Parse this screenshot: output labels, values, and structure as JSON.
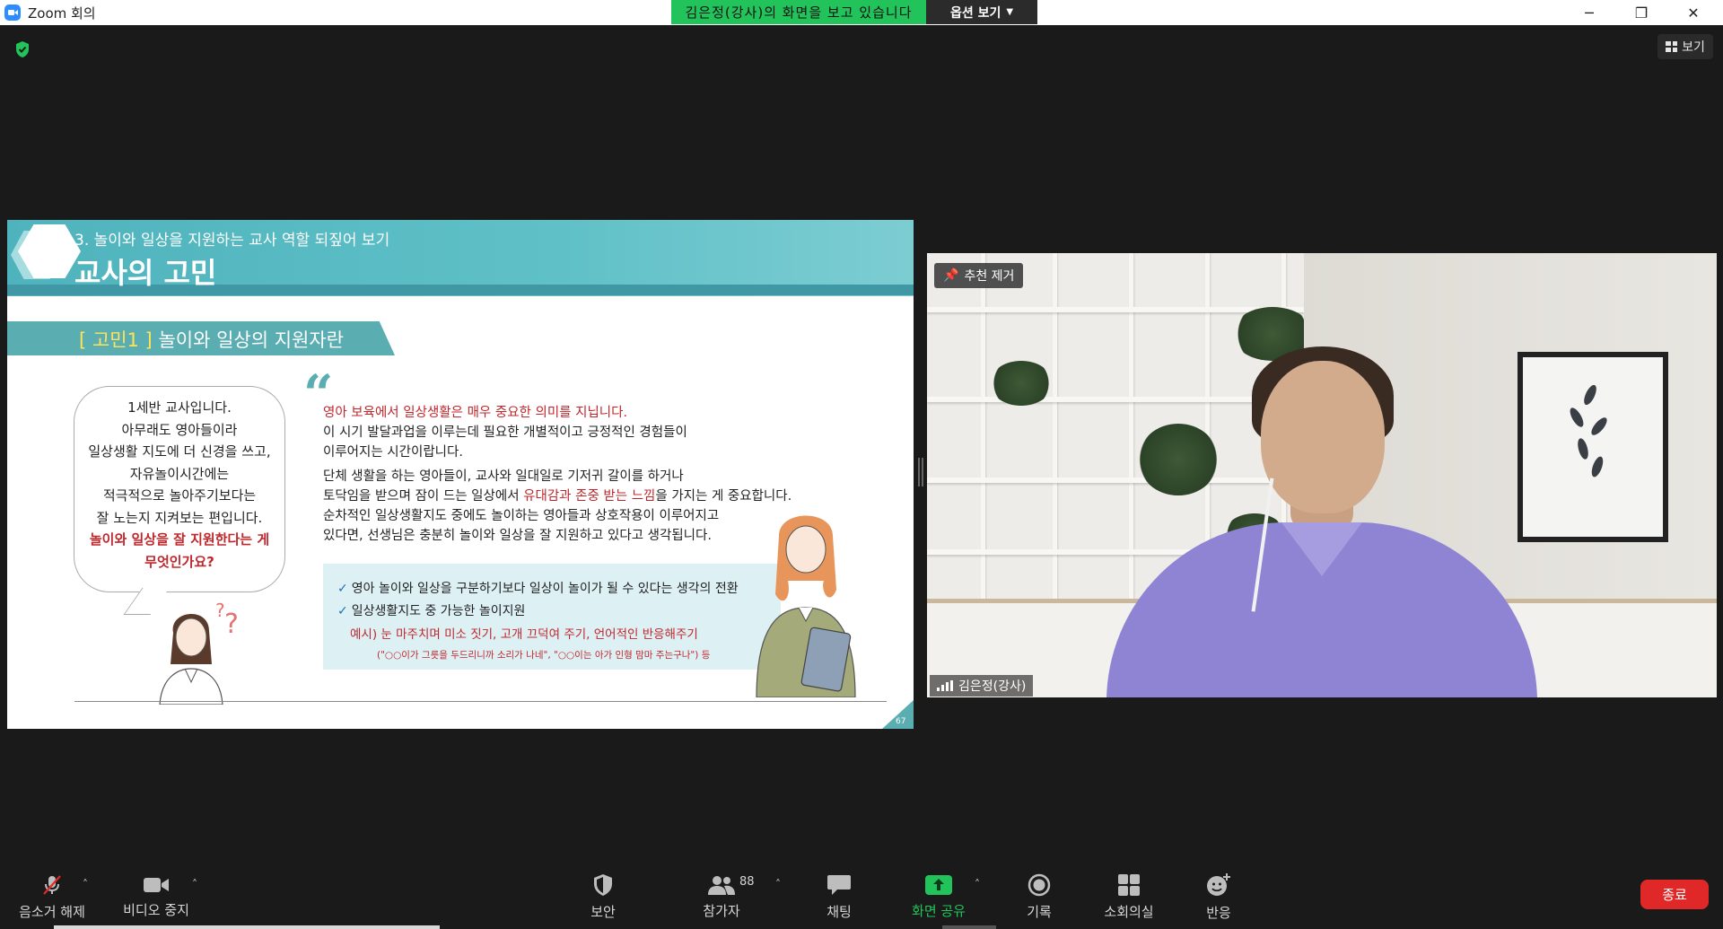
{
  "window": {
    "title": "Zoom 회의",
    "viewing_banner": "김은정(강사)의 화면을 보고 있습니다",
    "options_label": "옵션 보기",
    "minimize": "─",
    "restore": "❐",
    "close": "✕"
  },
  "view_button": {
    "label": "보기"
  },
  "slide": {
    "subtitle": "3. 놀이와 일상을 지원하는 교사 역할 되짚어 보기",
    "title": "교사의 고민",
    "tab_open": "[ 고민1 ]",
    "tab_text": "놀이와 일상의 지원자란",
    "speech_lines": [
      "1세반 교사입니다.",
      "아무래도 영아들이라",
      "일상생활 지도에 더 신경을 쓰고,",
      "자유놀이시간에는",
      "적극적으로 놀아주기보다는",
      "잘 노는지 지켜보는 편입니다."
    ],
    "speech_question": "놀이와 일상을 잘 지원한다는 게 무엇인가요?",
    "quote_mark": "“",
    "para1_red": "영아 보육에서 일상생활은 매우 중요한 의미를 지닙니다.",
    "para1_line2": "이 시기 발달과업을 이루는데 필요한 개별적이고 긍정적인 경험들이",
    "para1_line3": "이루어지는 시간이랍니다.",
    "para2_line1": "단체 생활을 하는 영아들이, 교사와 일대일로 기저귀 갈이를 하거나",
    "para2_line2_a": "토닥임을 받으며 잠이 드는 일상에서 ",
    "para2_line2_red": "유대감과 존중 받는 느낌",
    "para2_line2_b": "을 가지는 게 중요합니다.",
    "para3_line1": "순차적인 일상생활지도 중에도 놀이하는 영아들과 상호작용이 이루어지고",
    "para3_line2": "있다면, 선생님은 충분히 놀이와 일상을 잘 지원하고 있다고 생각됩니다.",
    "check_mark": "✓",
    "note1": "영아 놀이와 일상을 구분하기보다 일상이 놀이가 될 수 있다는 생각의 전환",
    "note2": "일상생활지도 중 가능한 놀이지원",
    "note3": "예시) 눈 마주치며 미소 짓기, 고개 끄덕여 주기, 언어적인 반응해주기",
    "note4": "(\"○○이가 그릇을 두드리니까 소리가 나네\", \"○○이는 아가 인형 맘마 주는구나\") 등",
    "page_number": "67"
  },
  "video": {
    "pin_label": "추천 제거",
    "participant_name": "김은정(강사)"
  },
  "toolbar": {
    "unmute": "음소거 해제",
    "stop_video": "비디오 중지",
    "security": "보안",
    "participants": "참가자",
    "participant_count": "88",
    "chat": "채팅",
    "share_screen": "화면 공유",
    "record": "기록",
    "breakout": "소회의실",
    "reactions": "반응",
    "end": "종료",
    "caret": "˄"
  },
  "colors": {
    "accent_teal": "#5aaeb2",
    "zoom_green": "#23c35c",
    "end_red": "#e02828",
    "highlight_red": "#c0272d"
  }
}
